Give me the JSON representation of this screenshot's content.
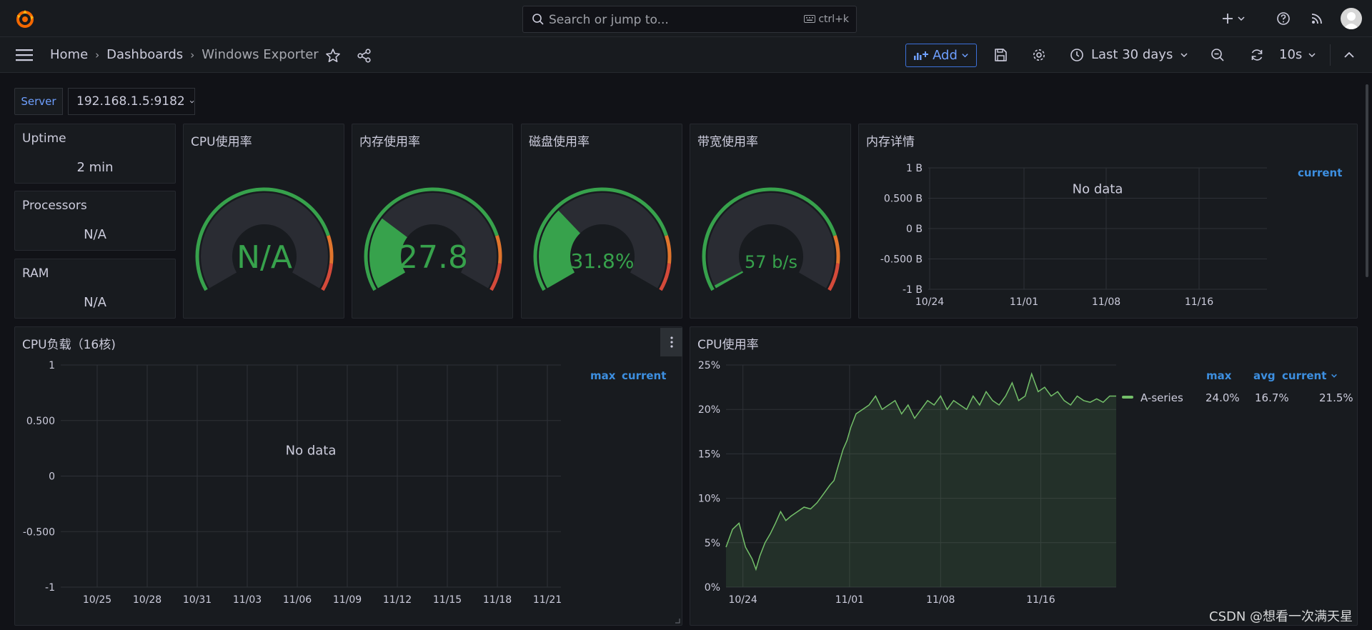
{
  "topbar": {
    "search_placeholder": "Search or jump to...",
    "search_shortcut": "ctrl+k",
    "icons": [
      "grafana-logo-icon",
      "plus-icon",
      "help-icon",
      "rss-icon",
      "avatar"
    ]
  },
  "navbar": {
    "breadcrumbs": [
      "Home",
      "Dashboards",
      "Windows Exporter"
    ],
    "add_label": "Add",
    "time_range": "Last 30 days",
    "refresh_interval": "10s"
  },
  "variables": {
    "server_label": "Server",
    "server_value": "192.168.1.5:9182"
  },
  "stats": {
    "uptime": {
      "title": "Uptime",
      "value": "2 min"
    },
    "processors": {
      "title": "Processors",
      "value": "N/A"
    },
    "ram": {
      "title": "RAM",
      "value": "N/A"
    }
  },
  "gauges": [
    {
      "title": "CPU使用率",
      "display": "N/A",
      "fraction": 0
    },
    {
      "title": "内存使用率",
      "display": "27.8",
      "fraction": 0.278
    },
    {
      "title": "磁盘使用率",
      "display": "31.8%",
      "fraction": 0.318
    },
    {
      "title": "带宽使用率",
      "display": "57 b/s",
      "fraction": 0.01
    }
  ],
  "colors": {
    "green": "#37a24c",
    "orange": "#e0752d",
    "red": "#d44a3a",
    "accent_blue": "#3d8fe0",
    "series_green": "#73bf69"
  },
  "mem_detail": {
    "title": "内存详情",
    "nodata": "No data",
    "legend_current": "current",
    "yticks": [
      "1 B",
      "0.500 B",
      "0 B",
      "-0.500 B",
      "-1 B"
    ],
    "xticks": [
      "10/24",
      "11/01",
      "11/08",
      "11/16"
    ]
  },
  "cpu_load": {
    "title": "CPU负载（16核)",
    "nodata": "No data",
    "legend": [
      "max",
      "current"
    ],
    "yticks": [
      "1",
      "0.500",
      "0",
      "-0.500",
      "-1"
    ],
    "xticks": [
      "10/25",
      "10/28",
      "10/31",
      "11/03",
      "11/06",
      "11/09",
      "11/12",
      "11/15",
      "11/18",
      "11/21"
    ]
  },
  "cpu_usage": {
    "title": "CPU使用率",
    "legend_headers": [
      "max",
      "avg",
      "current"
    ],
    "series_name": "A-series",
    "series_max": "24.0%",
    "series_avg": "16.7%",
    "series_current": "21.5%"
  },
  "chart_data": {
    "type": "area",
    "ylabel": "",
    "xlabel": "",
    "yticks": [
      "25%",
      "20%",
      "15%",
      "10%",
      "5%",
      "0%"
    ],
    "xticks": [
      "10/24",
      "11/01",
      "11/08",
      "11/16"
    ],
    "ylim": [
      0,
      25
    ],
    "x_day_range": [
      0,
      30
    ],
    "series": [
      {
        "name": "A-series",
        "x_days": [
          0,
          0.5,
          1,
          1.5,
          2,
          2.3,
          2.6,
          3,
          3.4,
          3.8,
          4.2,
          4.6,
          5,
          5.5,
          6,
          6.5,
          7,
          7.5,
          8,
          8.3,
          8.6,
          9,
          9.3,
          9.6,
          10,
          10.5,
          11,
          11.5,
          12,
          12.5,
          13,
          13.5,
          14,
          14.5,
          15,
          15.5,
          16,
          16.5,
          17,
          17.5,
          18,
          18.5,
          19,
          19.5,
          20,
          20.5,
          21,
          21.5,
          22,
          22.5,
          23,
          23.5,
          24,
          24.5,
          25,
          25.5,
          26,
          26.5,
          27,
          27.5,
          28,
          28.5,
          29,
          29.5,
          30
        ],
        "values": [
          4.5,
          6.5,
          7.2,
          4.5,
          3.2,
          2.0,
          3.5,
          5.0,
          6.0,
          7.2,
          8.5,
          7.5,
          8.0,
          8.5,
          9.0,
          8.8,
          9.5,
          10.5,
          11.5,
          12.0,
          13.5,
          15.5,
          16.5,
          18.0,
          19.5,
          20.0,
          20.5,
          21.5,
          20.0,
          20.5,
          21.0,
          19.5,
          20.5,
          19.0,
          20.0,
          21.0,
          20.5,
          21.5,
          20.0,
          21.0,
          20.5,
          20.0,
          21.5,
          20.5,
          22.0,
          21.0,
          20.5,
          21.5,
          23.0,
          21.0,
          21.5,
          24.0,
          22.0,
          22.5,
          21.5,
          22.0,
          21.0,
          20.5,
          21.5,
          21.0,
          20.8,
          21.2,
          20.8,
          21.5,
          21.5
        ]
      }
    ]
  },
  "watermark": "CSDN @想看一次满天星"
}
